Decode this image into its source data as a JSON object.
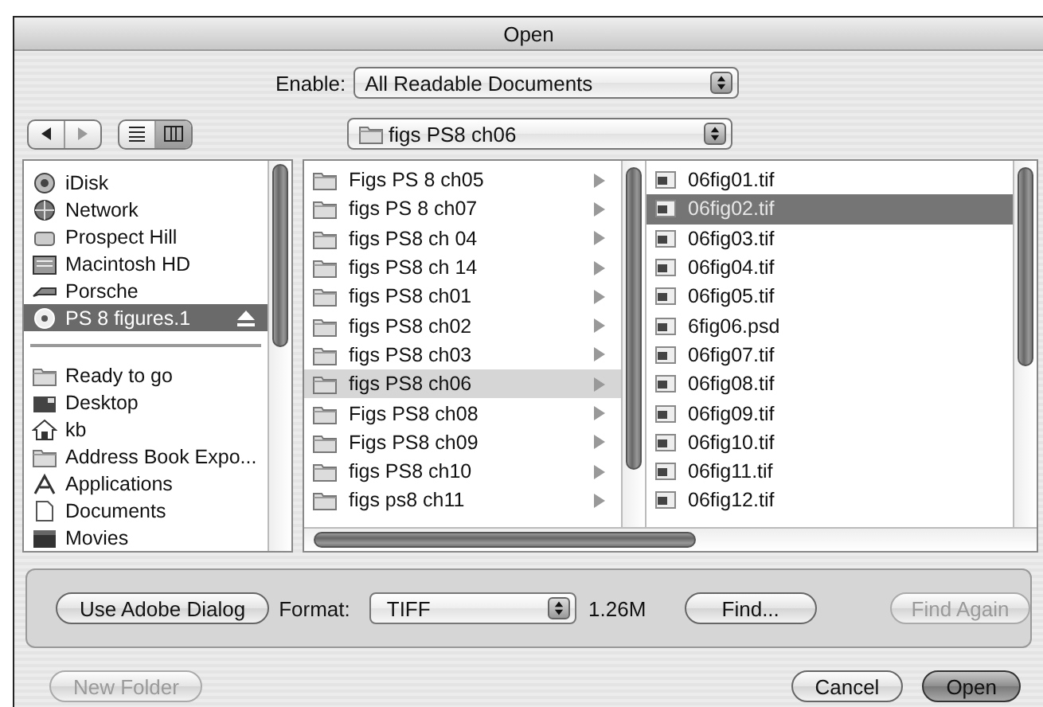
{
  "window": {
    "title": "Open"
  },
  "enable": {
    "label": "Enable:",
    "value": "All Readable Documents"
  },
  "view_buttons": [
    {
      "kind": "list",
      "selected": false
    },
    {
      "kind": "columns",
      "selected": true
    }
  ],
  "location": {
    "value": "figs PS8 ch06"
  },
  "sidebar": {
    "devices": [
      {
        "label": "iDisk",
        "kind": "idisk",
        "selected": false,
        "ejectable": false
      },
      {
        "label": "Network",
        "kind": "network",
        "selected": false,
        "ejectable": false
      },
      {
        "label": "Prospect Hill",
        "kind": "server",
        "selected": false,
        "ejectable": false
      },
      {
        "label": "Macintosh HD",
        "kind": "disk",
        "selected": false,
        "ejectable": false
      },
      {
        "label": "Porsche",
        "kind": "drive",
        "selected": false,
        "ejectable": false
      },
      {
        "label": "PS 8 figures.1",
        "kind": "disc",
        "selected": true,
        "ejectable": true
      }
    ],
    "places": [
      {
        "label": "Ready to go",
        "kind": "folder",
        "selected": false
      },
      {
        "label": "Desktop",
        "kind": "desktop",
        "selected": false
      },
      {
        "label": "kb",
        "kind": "home",
        "selected": false
      },
      {
        "label": "Address Book Expo...",
        "kind": "folder",
        "selected": false
      },
      {
        "label": "Applications",
        "kind": "applications",
        "selected": false
      },
      {
        "label": "Documents",
        "kind": "documents",
        "selected": false
      },
      {
        "label": "Movies",
        "kind": "movies",
        "selected": false
      }
    ]
  },
  "folders": [
    {
      "label": "Figs PS 8 ch05",
      "selected": false,
      "has_children": true
    },
    {
      "label": "figs PS 8 ch07",
      "selected": false,
      "has_children": true
    },
    {
      "label": "figs PS8 ch 04",
      "selected": false,
      "has_children": true
    },
    {
      "label": "figs PS8 ch 14",
      "selected": false,
      "has_children": true
    },
    {
      "label": "figs PS8 ch01",
      "selected": false,
      "has_children": true
    },
    {
      "label": "figs PS8 ch02",
      "selected": false,
      "has_children": true
    },
    {
      "label": "figs PS8 ch03",
      "selected": false,
      "has_children": true
    },
    {
      "label": "figs PS8 ch06",
      "selected": true,
      "has_children": true
    },
    {
      "label": "Figs PS8 ch08",
      "selected": false,
      "has_children": true
    },
    {
      "label": "Figs PS8 ch09",
      "selected": false,
      "has_children": true
    },
    {
      "label": "figs PS8 ch10",
      "selected": false,
      "has_children": true
    },
    {
      "label": "figs ps8 ch11",
      "selected": false,
      "has_children": true
    }
  ],
  "files": [
    {
      "label": "06fig01.tif",
      "selected": false
    },
    {
      "label": "06fig02.tif",
      "selected": true
    },
    {
      "label": "06fig03.tif",
      "selected": false
    },
    {
      "label": "06fig04.tif",
      "selected": false
    },
    {
      "label": "06fig05.tif",
      "selected": false
    },
    {
      "label": "6fig06.psd",
      "selected": false
    },
    {
      "label": "06fig07.tif",
      "selected": false
    },
    {
      "label": "06fig08.tif",
      "selected": false
    },
    {
      "label": "06fig09.tif",
      "selected": false
    },
    {
      "label": "06fig10.tif",
      "selected": false
    },
    {
      "label": "06fig11.tif",
      "selected": false
    },
    {
      "label": "06fig12.tif",
      "selected": false
    }
  ],
  "options": {
    "adobe_button": "Use Adobe Dialog",
    "format_label": "Format:",
    "format_value": "TIFF",
    "file_size": "1.26M",
    "find_button": {
      "label": "Find...",
      "disabled": false
    },
    "find_again_button": {
      "label": "Find Again",
      "disabled": true
    }
  },
  "buttons": [
    {
      "label": "New Folder",
      "kind": "new_folder",
      "disabled": true,
      "default": false
    },
    {
      "label": "Cancel",
      "kind": "cancel",
      "disabled": false,
      "default": false
    },
    {
      "label": "Open",
      "kind": "open",
      "disabled": false,
      "default": true
    }
  ]
}
